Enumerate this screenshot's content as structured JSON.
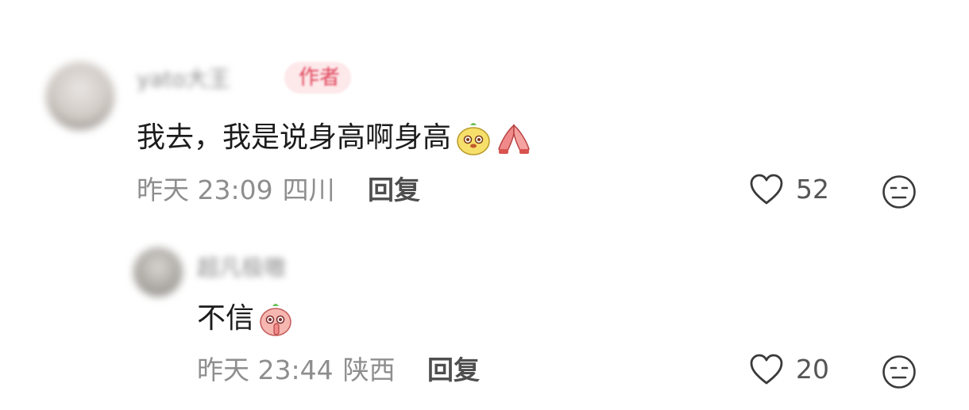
{
  "comments": [
    {
      "username": "yato大王",
      "badge": "作者",
      "text": "我去，我是说身高啊身高",
      "emojis": [
        "yellow-face-emoji",
        "praying-hands-emoji"
      ],
      "time": "昨天 23:09",
      "location": "四川",
      "reply_label": "回复",
      "likes": "52",
      "icon_like": "heart-outline-icon",
      "icon_dislike": "meh-face-icon"
    },
    {
      "username": "超凡极嗷",
      "text": "不信",
      "emojis": [
        "shush-peach-emoji"
      ],
      "time": "昨天 23:44",
      "location": "陕西",
      "reply_label": "回复",
      "likes": "20",
      "icon_like": "heart-outline-icon",
      "icon_dislike": "meh-face-icon"
    }
  ],
  "colors": {
    "badge_bg": "#fde8ea",
    "badge_text": "#e0455a",
    "meta": "#8e8e8e"
  }
}
